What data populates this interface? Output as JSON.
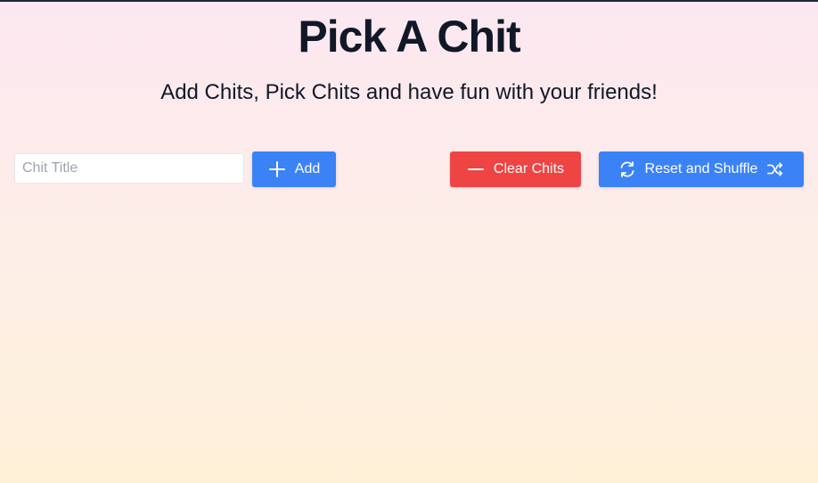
{
  "page": {
    "title": "Pick A Chit",
    "subtitle": "Add Chits, Pick Chits and have fun with your friends!"
  },
  "controls": {
    "chit_input": {
      "placeholder": "Chit Title",
      "value": ""
    },
    "add_button": {
      "label": "Add",
      "icon": "plus-icon",
      "color": "#3b82f6"
    },
    "clear_button": {
      "label": "Clear Chits",
      "icon": "minus-icon",
      "color": "#ef4444"
    },
    "reset_button": {
      "label": "Reset and Shuffle",
      "icon_left": "refresh-icon",
      "icon_right": "shuffle-icon",
      "color": "#3b82f6"
    }
  }
}
